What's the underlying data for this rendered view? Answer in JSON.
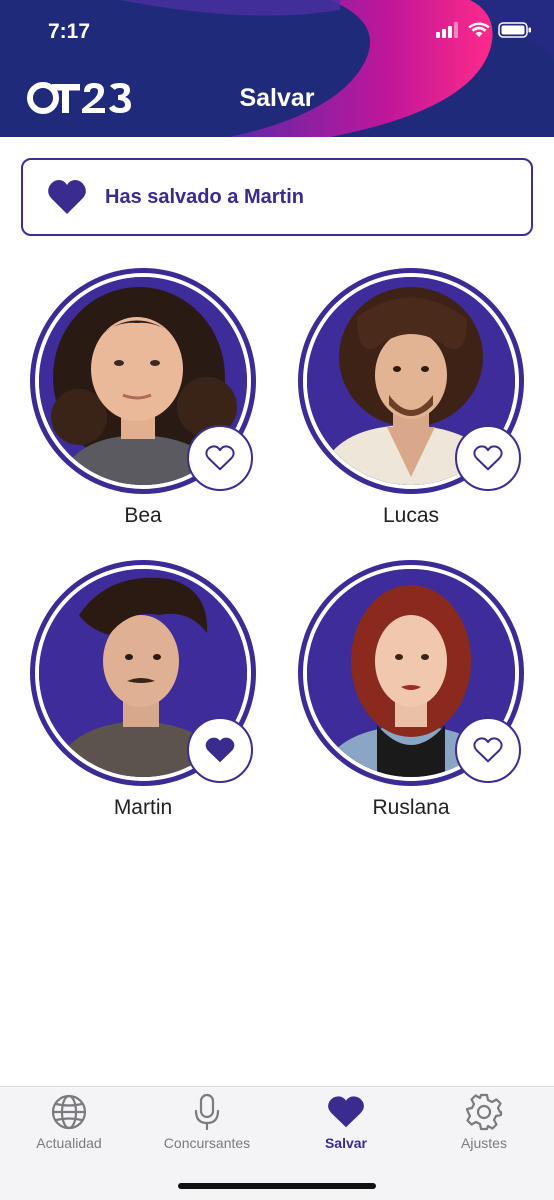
{
  "status_bar": {
    "time": "7:17"
  },
  "header": {
    "logo_text": "OT23",
    "title": "Salvar"
  },
  "banner": {
    "text": "Has salvado a Martin"
  },
  "contestants": [
    {
      "name": "Bea",
      "saved": false
    },
    {
      "name": "Lucas",
      "saved": false
    },
    {
      "name": "Martin",
      "saved": true
    },
    {
      "name": "Ruslana",
      "saved": false
    }
  ],
  "tabs": [
    {
      "label": "Actualidad",
      "icon": "globe-icon",
      "active": false
    },
    {
      "label": "Concursantes",
      "icon": "microphone-icon",
      "active": false
    },
    {
      "label": "Salvar",
      "icon": "heart-icon",
      "active": true
    },
    {
      "label": "Ajustes",
      "icon": "gear-icon",
      "active": false
    }
  ],
  "colors": {
    "accent": "#3a2b8e",
    "header_bg": "#1f2a7a",
    "magenta": "#e0188a"
  }
}
